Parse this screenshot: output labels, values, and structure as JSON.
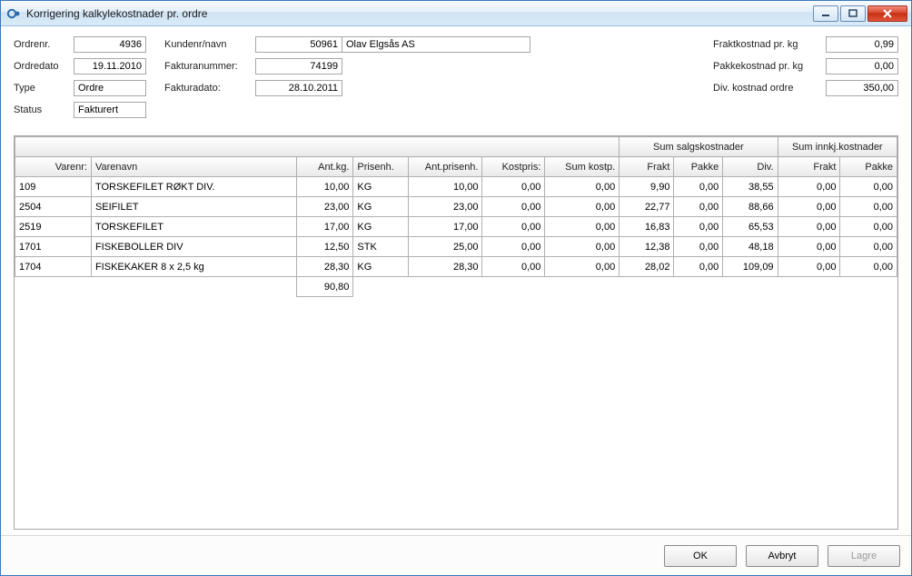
{
  "window": {
    "title": "Korrigering kalkylekostnader pr. ordre"
  },
  "form": {
    "ordrenr_label": "Ordrenr.",
    "ordrenr": "4936",
    "ordredato_label": "Ordredato",
    "ordredato": "19.11.2010",
    "type_label": "Type",
    "type": "Ordre",
    "status_label": "Status",
    "status": "Fakturert",
    "kundenr_label": "Kundenr/navn",
    "kundenr": "50961",
    "kundenavn": "Olav Elgsås AS",
    "fakturanr_label": "Fakturanummer:",
    "fakturanr": "74199",
    "fakturadato_label": "Fakturadato:",
    "fakturadato": "28.10.2011",
    "fraktkost_label": "Fraktkostnad pr. kg",
    "fraktkost": "0,99",
    "pakkekost_label": "Pakkekostnad pr. kg",
    "pakkekost": "0,00",
    "divkost_label": "Div. kostnad ordre",
    "divkost": "350,00"
  },
  "grid": {
    "group1": "Sum salgskostnader",
    "group2": "Sum innkj.kostnader",
    "headers": {
      "varenr": "Varenr:",
      "varenavn": "Varenavn",
      "antkg": "Ant.kg.",
      "prisenh": "Prisenh.",
      "antprisenh": "Ant.prisenh.",
      "kostpris": "Kostpris:",
      "sumkostp": "Sum kostp.",
      "frakt": "Frakt",
      "pakke": "Pakke",
      "div": "Div.",
      "frakt2": "Frakt",
      "pakke2": "Pakke"
    },
    "rows": [
      {
        "varenr": "109",
        "varenavn": "TORSKEFILET RØKT DIV.",
        "antkg": "10,00",
        "prisenh": "KG",
        "antprisenh": "10,00",
        "kostpris": "0,00",
        "sumkostp": "0,00",
        "frakt": "9,90",
        "pakke": "0,00",
        "div": "38,55",
        "frakt2": "0,00",
        "pakke2": "0,00"
      },
      {
        "varenr": "2504",
        "varenavn": "SEIFILET",
        "antkg": "23,00",
        "prisenh": "KG",
        "antprisenh": "23,00",
        "kostpris": "0,00",
        "sumkostp": "0,00",
        "frakt": "22,77",
        "pakke": "0,00",
        "div": "88,66",
        "frakt2": "0,00",
        "pakke2": "0,00"
      },
      {
        "varenr": "2519",
        "varenavn": "TORSKEFILET",
        "antkg": "17,00",
        "prisenh": "KG",
        "antprisenh": "17,00",
        "kostpris": "0,00",
        "sumkostp": "0,00",
        "frakt": "16,83",
        "pakke": "0,00",
        "div": "65,53",
        "frakt2": "0,00",
        "pakke2": "0,00"
      },
      {
        "varenr": "1701",
        "varenavn": "FISKEBOLLER DIV",
        "antkg": "12,50",
        "prisenh": "STK",
        "antprisenh": "25,00",
        "kostpris": "0,00",
        "sumkostp": "0,00",
        "frakt": "12,38",
        "pakke": "0,00",
        "div": "48,18",
        "frakt2": "0,00",
        "pakke2": "0,00"
      },
      {
        "varenr": "1704",
        "varenavn": "FISKEKAKER 8 x 2,5 kg",
        "antkg": "28,30",
        "prisenh": "KG",
        "antprisenh": "28,30",
        "kostpris": "0,00",
        "sumkostp": "0,00",
        "frakt": "28,02",
        "pakke": "0,00",
        "div": "109,09",
        "frakt2": "0,00",
        "pakke2": "0,00"
      }
    ],
    "total_antkg": "90,80"
  },
  "buttons": {
    "ok": "OK",
    "avbryt": "Avbryt",
    "lagre": "Lagre"
  }
}
